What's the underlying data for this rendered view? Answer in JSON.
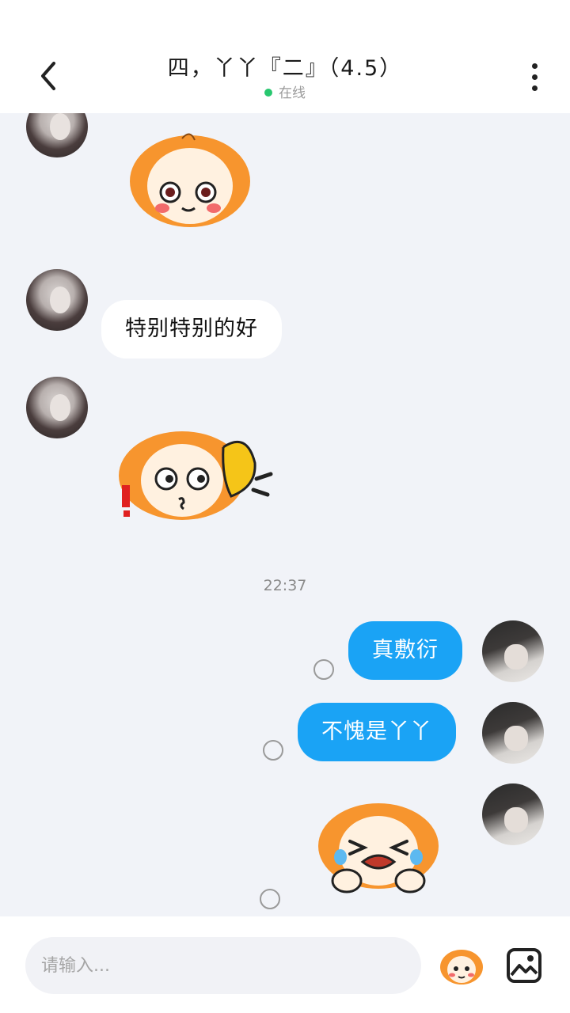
{
  "header": {
    "title": "四，丫丫『二』（4.5）",
    "status": "在线"
  },
  "messages": {
    "m2_text": "特别特别的好",
    "time": "22:37",
    "m4_text": "真敷衍",
    "m5_text": "不愧是丫丫"
  },
  "stickers": {
    "s1": "orange-hair-girl-staring",
    "s2": "orange-hair-girl-listening",
    "s3": "orange-hair-girl-crying"
  },
  "input": {
    "placeholder": "请输入..."
  },
  "colors": {
    "outgoing_bubble": "#1aa3f5",
    "incoming_bubble": "#ffffff",
    "online_dot": "#28c76f",
    "sticker_orange": "#f7952e"
  },
  "icons": {
    "back": "chevron-left-icon",
    "more": "more-vertical-icon",
    "emoji": "sticker-face-icon",
    "image": "image-icon"
  }
}
